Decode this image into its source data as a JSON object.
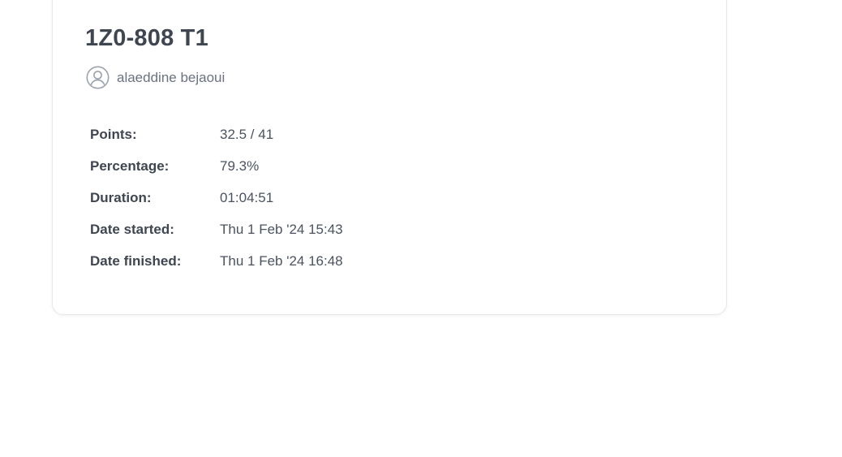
{
  "card": {
    "title": "1Z0-808 T1",
    "author": {
      "icon": "user-circle-icon",
      "name": "alaeddine bejaoui"
    },
    "stats": [
      {
        "label": "Points:",
        "value": "32.5 / 41"
      },
      {
        "label": "Percentage:",
        "value": "79.3%"
      },
      {
        "label": "Duration:",
        "value": "01:04:51"
      },
      {
        "label": "Date started:",
        "value": "Thu 1 Feb '24 15:43"
      },
      {
        "label": "Date finished:",
        "value": "Thu 1 Feb '24 16:48"
      }
    ]
  },
  "colors": {
    "text": "#3f4650",
    "muted": "#6b7280",
    "border": "#e6e8eb",
    "icon": "#9ca3af"
  }
}
